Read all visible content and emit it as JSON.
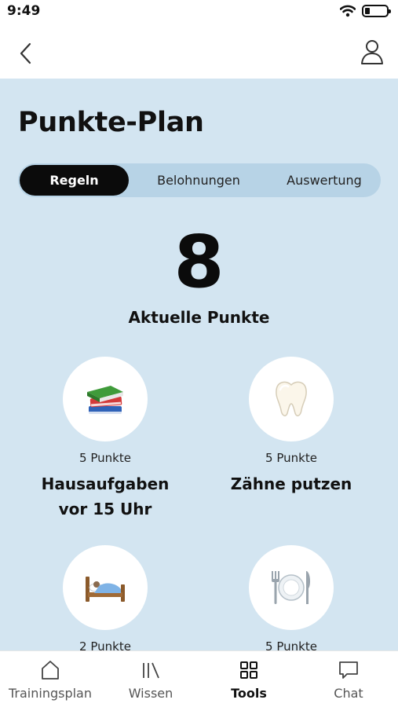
{
  "status": {
    "time": "9:49"
  },
  "title": "Punkte-Plan",
  "tabs": [
    {
      "label": "Regeln",
      "active": true
    },
    {
      "label": "Belohnungen",
      "active": false
    },
    {
      "label": "Auswertung",
      "active": false
    }
  ],
  "points": {
    "value": "8",
    "label": "Aktuelle Punkte"
  },
  "rules": [
    {
      "icon": "books-icon",
      "points": "5 Punkte",
      "title_line1": "Hausaufgaben",
      "title_line2": "vor 15 Uhr"
    },
    {
      "icon": "tooth-icon",
      "points": "5 Punkte",
      "title_line1": "Zähne putzen",
      "title_line2": ""
    },
    {
      "icon": "bed-icon",
      "points": "2 Punkte",
      "title_line1": "",
      "title_line2": ""
    },
    {
      "icon": "plate-icon",
      "points": "5 Punkte",
      "title_line1": "",
      "title_line2": ""
    }
  ],
  "bottom_nav": [
    {
      "label": "Trainingsplan",
      "icon": "home-icon",
      "active": false
    },
    {
      "label": "Wissen",
      "icon": "library-icon",
      "active": false
    },
    {
      "label": "Tools",
      "icon": "grid-icon",
      "active": true
    },
    {
      "label": "Chat",
      "icon": "chat-icon",
      "active": false
    }
  ],
  "colors": {
    "background": "#d3e5f1",
    "tab_track": "#b7d3e6",
    "active_tab": "#0b0b0b"
  }
}
